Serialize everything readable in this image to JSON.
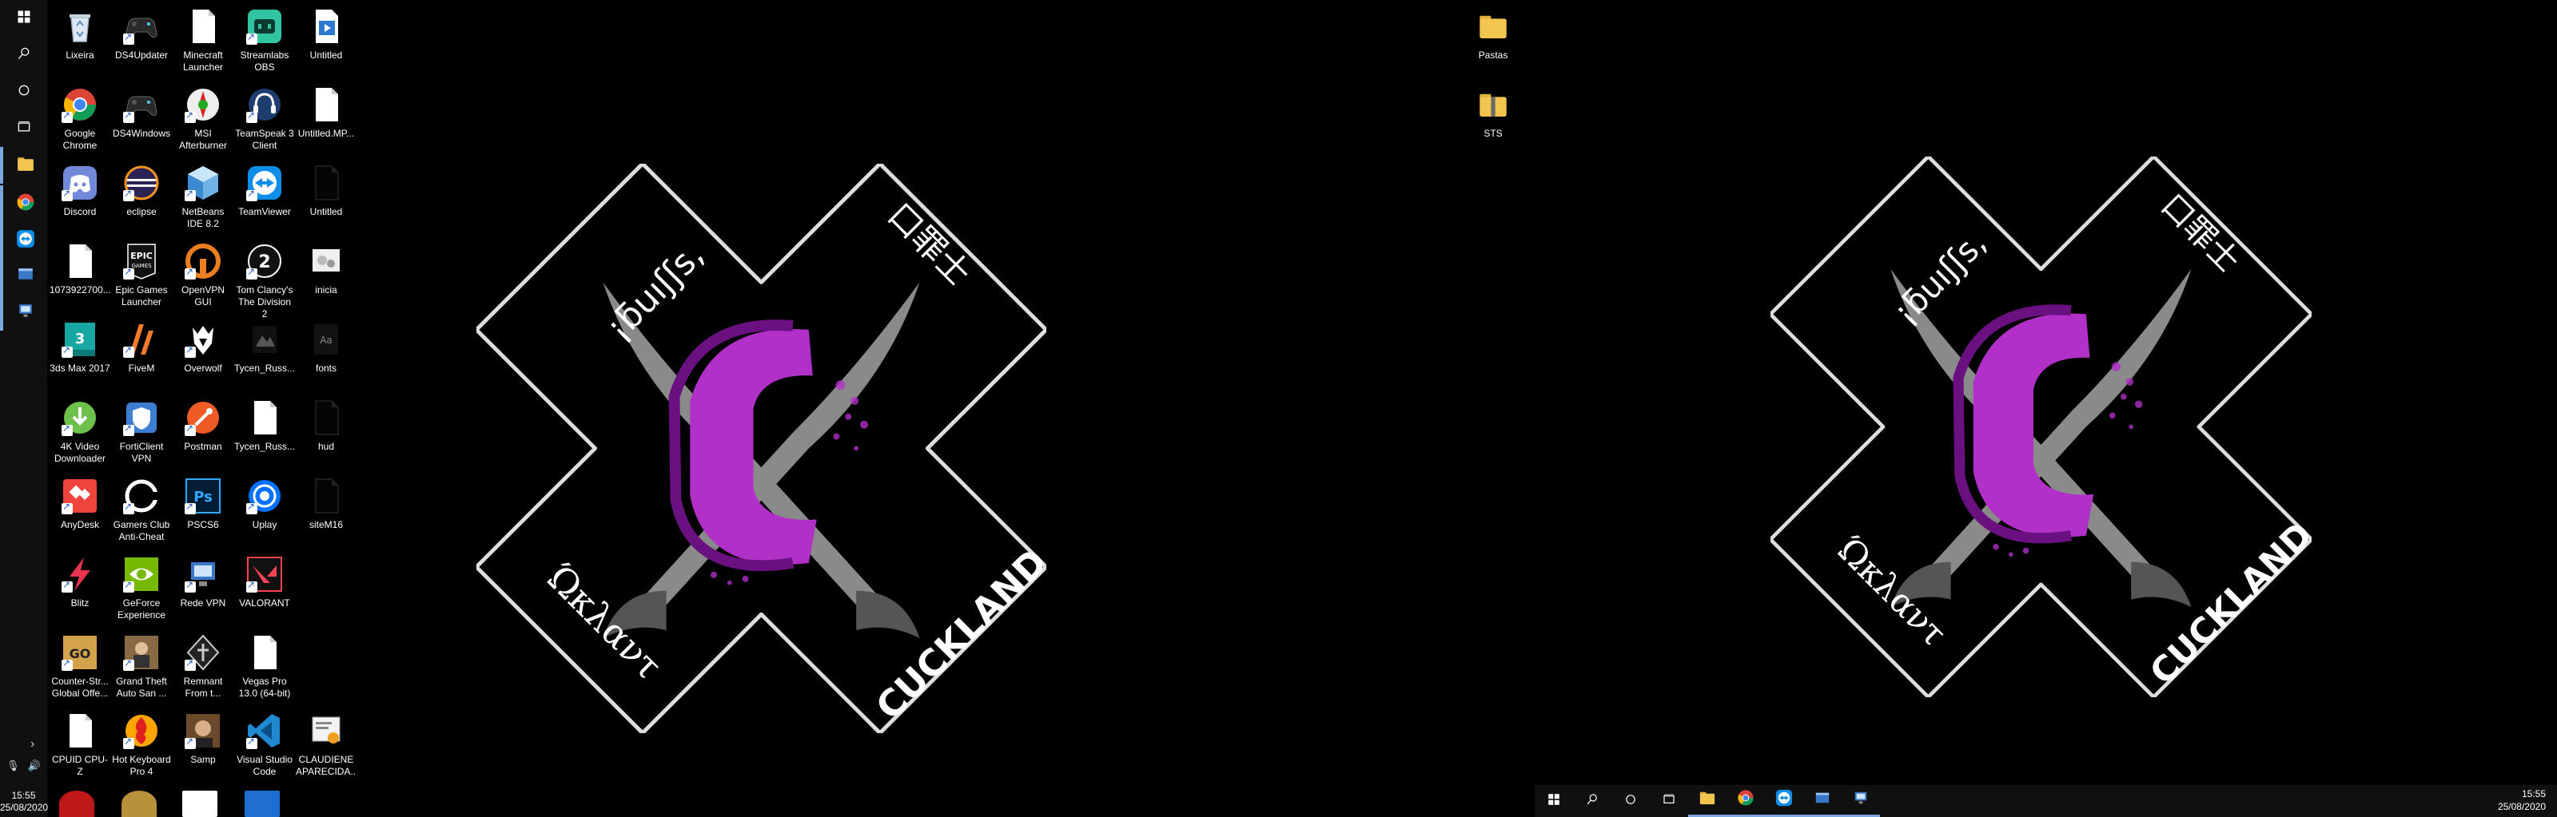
{
  "left_taskbar": {
    "buttons": [
      {
        "name": "start-button",
        "icon": "windows-icon"
      },
      {
        "name": "search-button",
        "icon": "search-icon"
      },
      {
        "name": "cortana-button",
        "icon": "cortana-icon"
      },
      {
        "name": "task-view-button",
        "icon": "task-view-icon"
      },
      {
        "name": "file-explorer-button",
        "icon": "folder-icon"
      },
      {
        "name": "chrome-button",
        "icon": "chrome-icon"
      },
      {
        "name": "teamviewer-button",
        "icon": "teamviewer-icon"
      },
      {
        "name": "app-button-1",
        "icon": "window-icon"
      },
      {
        "name": "app-button-2",
        "icon": "network-icon"
      }
    ],
    "clock": {
      "time": "15:55",
      "date": "25/08/2020"
    }
  },
  "desktop_icons": [
    {
      "label": "Lixeira",
      "icon": "recycle-bin-icon",
      "col": 0,
      "row": 0
    },
    {
      "label": "DS4Updater",
      "icon": "gamepad-icon",
      "col": 1,
      "row": 0
    },
    {
      "label": "Minecraft Launcher",
      "icon": "document-icon",
      "col": 2,
      "row": 0
    },
    {
      "label": "Streamlabs OBS",
      "icon": "streamlabs-icon",
      "col": 3,
      "row": 0
    },
    {
      "label": "Untitled",
      "icon": "video-file-icon",
      "col": 4,
      "row": 0
    },
    {
      "label": "Google Chrome",
      "icon": "chrome-icon",
      "col": 0,
      "row": 1
    },
    {
      "label": "DS4Windows",
      "icon": "gamepad-icon",
      "col": 1,
      "row": 1
    },
    {
      "label": "MSI Afterburner",
      "icon": "msi-afterburner-icon",
      "col": 2,
      "row": 1
    },
    {
      "label": "TeamSpeak 3 Client",
      "icon": "teamspeak-icon",
      "col": 3,
      "row": 1
    },
    {
      "label": "Untitled.MP...",
      "icon": "document-icon",
      "col": 4,
      "row": 1
    },
    {
      "label": "Discord",
      "icon": "discord-icon",
      "col": 0,
      "row": 2
    },
    {
      "label": "eclipse",
      "icon": "eclipse-icon",
      "col": 1,
      "row": 2
    },
    {
      "label": "NetBeans IDE 8.2",
      "icon": "netbeans-icon",
      "col": 2,
      "row": 2
    },
    {
      "label": "TeamViewer",
      "icon": "teamviewer-icon",
      "col": 3,
      "row": 2
    },
    {
      "label": "Untitled",
      "icon": "black-file-icon",
      "col": 4,
      "row": 2
    },
    {
      "label": "1073922700...",
      "icon": "document-icon",
      "col": 0,
      "row": 3
    },
    {
      "label": "Epic Games Launcher",
      "icon": "epic-games-icon",
      "col": 1,
      "row": 3
    },
    {
      "label": "OpenVPN GUI",
      "icon": "openvpn-icon",
      "col": 2,
      "row": 3
    },
    {
      "label": "Tom Clancy's The Division 2",
      "icon": "division2-icon",
      "col": 3,
      "row": 3
    },
    {
      "label": "inicia",
      "icon": "batch-file-icon",
      "col": 4,
      "row": 3
    },
    {
      "label": "3ds Max 2017",
      "icon": "3dsmax-icon",
      "col": 0,
      "row": 4
    },
    {
      "label": "FiveM",
      "icon": "fivem-icon",
      "col": 1,
      "row": 4
    },
    {
      "label": "Overwolf",
      "icon": "overwolf-icon",
      "col": 2,
      "row": 4
    },
    {
      "label": "Tycen_Russ...",
      "icon": "image-file-icon",
      "col": 3,
      "row": 4
    },
    {
      "label": "fonts",
      "icon": "fonts-file-icon",
      "col": 4,
      "row": 4
    },
    {
      "label": "4K Video Downloader",
      "icon": "4k-downloader-icon",
      "col": 0,
      "row": 5
    },
    {
      "label": "FortiClient VPN",
      "icon": "forticlient-icon",
      "col": 1,
      "row": 5
    },
    {
      "label": "Postman",
      "icon": "postman-icon",
      "col": 2,
      "row": 5
    },
    {
      "label": "Tycen_Russ...",
      "icon": "document-icon",
      "col": 3,
      "row": 5
    },
    {
      "label": "hud",
      "icon": "black-file-icon",
      "col": 4,
      "row": 5
    },
    {
      "label": "AnyDesk",
      "icon": "anydesk-icon",
      "col": 0,
      "row": 6
    },
    {
      "label": "Gamers Club Anti-Cheat",
      "icon": "gamersclub-icon",
      "col": 1,
      "row": 6
    },
    {
      "label": "PSCS6",
      "icon": "photoshop-icon",
      "col": 2,
      "row": 6
    },
    {
      "label": "Uplay",
      "icon": "uplay-icon",
      "col": 3,
      "row": 6
    },
    {
      "label": "siteM16",
      "icon": "black-file-icon",
      "col": 4,
      "row": 6
    },
    {
      "label": "Blitz",
      "icon": "blitz-icon",
      "col": 0,
      "row": 7
    },
    {
      "label": "GeForce Experience",
      "icon": "nvidia-icon",
      "col": 1,
      "row": 7
    },
    {
      "label": "Rede VPN",
      "icon": "network-icon",
      "col": 2,
      "row": 7
    },
    {
      "label": "VALORANT",
      "icon": "valorant-icon",
      "col": 3,
      "row": 7
    },
    {
      "label": "Counter-Str... Global Offe...",
      "icon": "csgo-icon",
      "col": 0,
      "row": 8
    },
    {
      "label": "Grand Theft Auto San ...",
      "icon": "gta-icon",
      "col": 1,
      "row": 8
    },
    {
      "label": "Remnant From t...",
      "icon": "remnant-icon",
      "col": 2,
      "row": 8
    },
    {
      "label": "Vegas Pro 13.0 (64-bit)",
      "icon": "document-icon",
      "col": 3,
      "row": 8
    },
    {
      "label": "CPUID CPU-Z",
      "icon": "document-icon",
      "col": 0,
      "row": 9
    },
    {
      "label": "Hot Keyboard Pro 4",
      "icon": "hotkeyboard-icon",
      "col": 1,
      "row": 9
    },
    {
      "label": "Samp",
      "icon": "samp-icon",
      "col": 2,
      "row": 9
    },
    {
      "label": "Visual Studio Code",
      "icon": "vscode-icon",
      "col": 3,
      "row": 9
    },
    {
      "label": "CLAUDIENE APARECIDA...",
      "icon": "certificate-icon",
      "col": 4,
      "row": 9
    }
  ],
  "right_desktop_icons": [
    {
      "label": "Pastas",
      "icon": "folder-icon"
    },
    {
      "label": "STS",
      "icon": "folder-zip-icon"
    }
  ],
  "wallpaper": {
    "text_top_left": "¡ƃuıʃʃs,",
    "text_top_right": "口罪士",
    "text_bottom_left": "Ώκλαντ",
    "text_bottom_right": "CUCKLAND",
    "letter": "C",
    "accent": "#b030c8"
  },
  "bottom_taskbar": {
    "buttons": [
      {
        "name": "start-button",
        "icon": "windows-icon"
      },
      {
        "name": "search-button",
        "icon": "search-icon"
      },
      {
        "name": "cortana-button",
        "icon": "cortana-icon"
      },
      {
        "name": "task-view-button",
        "icon": "task-view-icon"
      },
      {
        "name": "file-explorer-button",
        "icon": "folder-icon"
      },
      {
        "name": "chrome-button",
        "icon": "chrome-icon"
      },
      {
        "name": "teamviewer-button",
        "icon": "teamviewer-icon"
      },
      {
        "name": "app-button-1",
        "icon": "window-icon"
      },
      {
        "name": "app-button-2",
        "icon": "network-icon"
      }
    ],
    "clock": {
      "time": "15:55",
      "date": "25/08/2020"
    }
  }
}
